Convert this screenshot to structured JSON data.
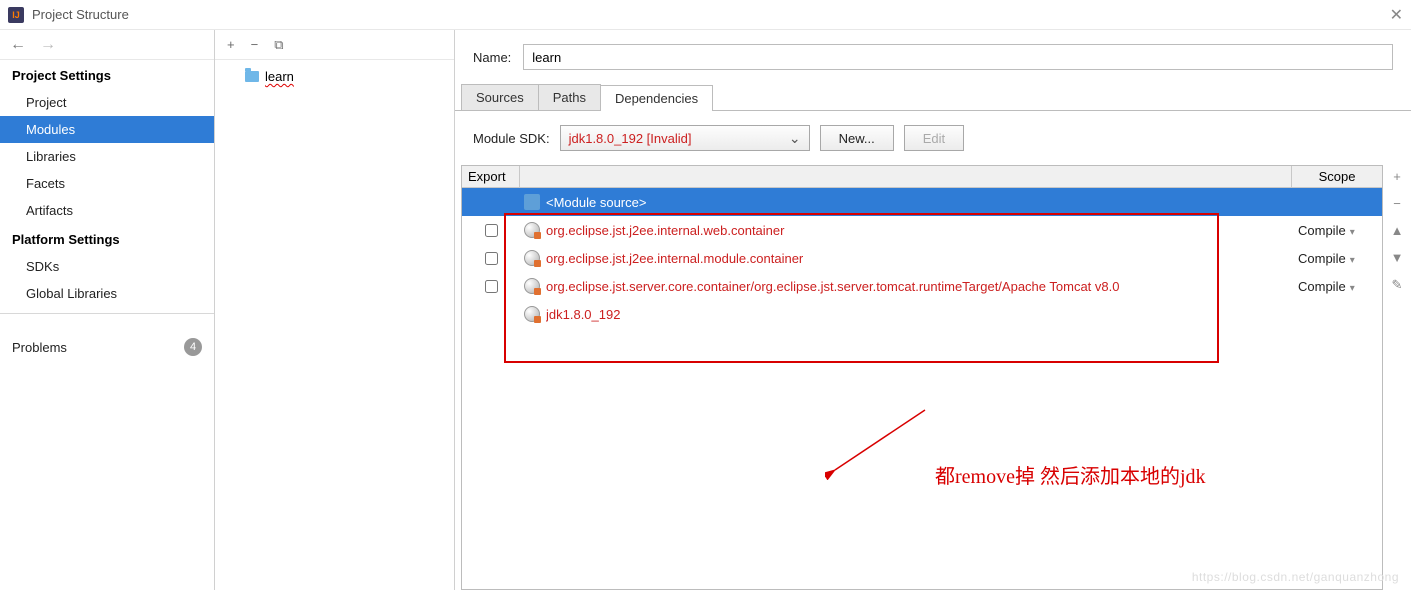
{
  "window": {
    "title": "Project Structure"
  },
  "sidebar": {
    "section1_title": "Project Settings",
    "items1": [
      "Project",
      "Modules",
      "Libraries",
      "Facets",
      "Artifacts"
    ],
    "section2_title": "Platform Settings",
    "items2": [
      "SDKs",
      "Global Libraries"
    ],
    "problems_label": "Problems",
    "problems_count": "4"
  },
  "tree": {
    "module_name": "learn"
  },
  "content": {
    "name_label": "Name:",
    "name_value": "learn",
    "tabs": [
      "Sources",
      "Paths",
      "Dependencies"
    ],
    "sdk_label": "Module SDK:",
    "sdk_value": "jdk1.8.0_192 [Invalid]",
    "new_btn": "New...",
    "edit_btn": "Edit",
    "headers": {
      "export": "Export",
      "scope": "Scope"
    },
    "deps": [
      {
        "name": "<Module source>",
        "type": "module",
        "selected": true
      },
      {
        "name": "org.eclipse.jst.j2ee.internal.web.container",
        "type": "invalid",
        "checkbox": true,
        "scope": "Compile"
      },
      {
        "name": "org.eclipse.jst.j2ee.internal.module.container",
        "type": "invalid",
        "checkbox": true,
        "scope": "Compile"
      },
      {
        "name": "org.eclipse.jst.server.core.container/org.eclipse.jst.server.tomcat.runtimeTarget/Apache Tomcat v8.0",
        "type": "invalid",
        "checkbox": true,
        "scope": "Compile"
      },
      {
        "name": "jdk1.8.0_192",
        "type": "invalid"
      }
    ]
  },
  "annotation": "都remove掉   然后添加本地的jdk",
  "watermark": "https://blog.csdn.net/ganquanzhong"
}
